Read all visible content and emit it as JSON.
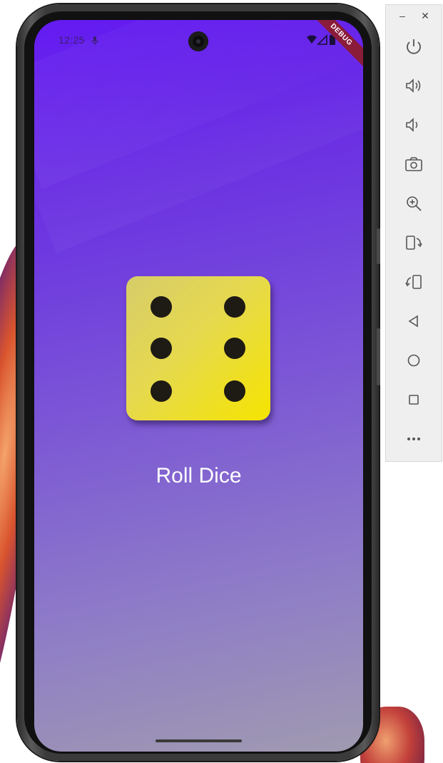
{
  "status_bar": {
    "time": "12:25"
  },
  "debug_banner": "DEBUG",
  "dice": {
    "value": 6,
    "color_light": "#d6cc6a",
    "color_dark": "#f5e400",
    "pip_color": "#1e1a14"
  },
  "roll_button": {
    "label": "Roll Dice"
  },
  "background": {
    "gradient_top": "#5a0cf0",
    "gradient_bottom": "#a09ab0"
  },
  "emulator_toolbar": {
    "window_controls": [
      "minimize-icon",
      "close-icon"
    ],
    "minimize_glyph": "–",
    "close_glyph": "✕",
    "buttons": [
      {
        "name": "power-icon"
      },
      {
        "name": "volume-up-icon"
      },
      {
        "name": "volume-down-icon"
      },
      {
        "name": "camera-icon"
      },
      {
        "name": "zoom-in-icon"
      },
      {
        "name": "rotate-left-icon"
      },
      {
        "name": "rotate-right-icon"
      },
      {
        "name": "back-icon"
      },
      {
        "name": "home-icon"
      },
      {
        "name": "overview-icon"
      },
      {
        "name": "more-icon"
      }
    ]
  }
}
